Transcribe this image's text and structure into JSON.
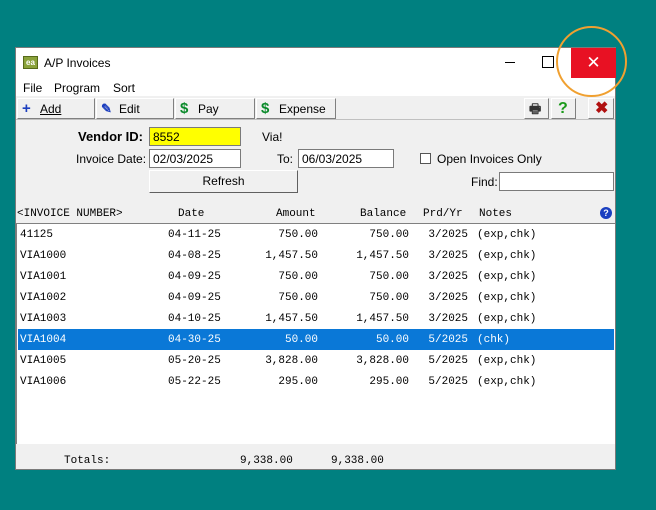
{
  "window": {
    "title": "A/P Invoices",
    "icon": "app-icon",
    "icon_text": "ea",
    "minimize_icon": "minimize-icon",
    "maximize_icon": "maximize-icon",
    "close_glyph": "✕"
  },
  "menu": {
    "items": [
      "File",
      "Program",
      "Sort"
    ]
  },
  "toolbar": {
    "add_label": "Add",
    "edit_label": "Edit",
    "pay_label": "Pay",
    "expense_label": "Expense",
    "add_icon": "+",
    "edit_icon": "✎",
    "pay_icon": "$",
    "expense_icon": "$",
    "print_icon": "🖶",
    "help_icon": "?",
    "delete_icon": "✖"
  },
  "filter": {
    "vendor_label": "Vendor ID:",
    "vendor_value": "8552",
    "vendor_name": "Via!",
    "invoice_date_label": "Invoice Date:",
    "invoice_date_value": "02/03/2025",
    "to_label": "To:",
    "to_value": "06/03/2025",
    "open_only_label": "Open Invoices Only",
    "open_only_checked": false,
    "find_label": "Find:",
    "find_value": "",
    "refresh_label": "Refresh"
  },
  "columns": {
    "invoice": "<INVOICE NUMBER>",
    "date": "Date",
    "amount": "Amount",
    "balance": "Balance",
    "period": "Prd/Yr",
    "notes": "Notes",
    "help": "?"
  },
  "rows": [
    {
      "invoice": "41125",
      "date": "04-11-25",
      "amount": "750.00",
      "balance": "750.00",
      "period": "3/2025",
      "notes": "(exp,chk)"
    },
    {
      "invoice": "VIA1000",
      "date": "04-08-25",
      "amount": "1,457.50",
      "balance": "1,457.50",
      "period": "3/2025",
      "notes": "(exp,chk)"
    },
    {
      "invoice": "VIA1001",
      "date": "04-09-25",
      "amount": "750.00",
      "balance": "750.00",
      "period": "3/2025",
      "notes": "(exp,chk)"
    },
    {
      "invoice": "VIA1002",
      "date": "04-09-25",
      "amount": "750.00",
      "balance": "750.00",
      "period": "3/2025",
      "notes": "(exp,chk)"
    },
    {
      "invoice": "VIA1003",
      "date": "04-10-25",
      "amount": "1,457.50",
      "balance": "1,457.50",
      "period": "3/2025",
      "notes": "(exp,chk)"
    },
    {
      "invoice": "VIA1004",
      "date": "04-30-25",
      "amount": "50.00",
      "balance": "50.00",
      "period": "5/2025",
      "notes": "(chk)"
    },
    {
      "invoice": "VIA1005",
      "date": "05-20-25",
      "amount": "3,828.00",
      "balance": "3,828.00",
      "period": "5/2025",
      "notes": "(exp,chk)"
    },
    {
      "invoice": "VIA1006",
      "date": "05-22-25",
      "amount": "295.00",
      "balance": "295.00",
      "period": "5/2025",
      "notes": "(exp,chk)"
    }
  ],
  "selected_row": 5,
  "totals": {
    "label": "Totals:",
    "amount": "9,338.00",
    "balance": "9,338.00"
  },
  "colors": {
    "desktop": "#008080",
    "close_button": "#e81123",
    "selection": "#0a78d7",
    "vendor_field": "#ffff00",
    "highlight_ring": "#f0a030"
  }
}
